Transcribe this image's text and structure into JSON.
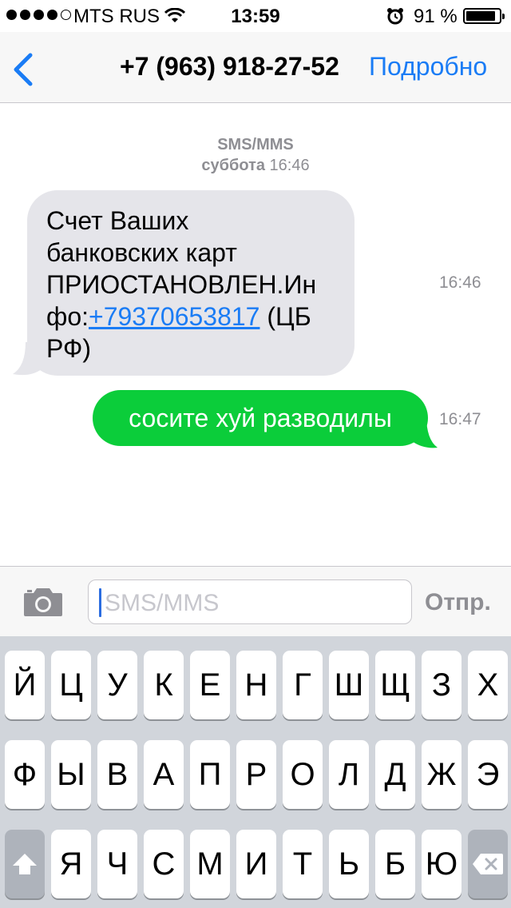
{
  "status_bar": {
    "carrier": "MTS RUS",
    "time": "13:59",
    "battery_percent": "91 %",
    "battery_level": 0.91,
    "signal_bars_filled": 4,
    "signal_bars_total": 5
  },
  "nav": {
    "back_icon": "chevron-left-icon",
    "title": "+7 (963) 918-27-52",
    "details_label": "Подробно"
  },
  "conversation": {
    "service_label": "SMS/MMS",
    "date_day": "суббота",
    "date_time": "16:46",
    "messages": [
      {
        "direction": "incoming",
        "lines": [
          "Счет Ваших",
          "банковских карт",
          "ПРИОСТАНОВЛЕН.Ин",
          "фо:"
        ],
        "link": "+79370653817",
        "after_link": " (ЦБ",
        "last_line": "РФ)",
        "time": "16:46"
      },
      {
        "direction": "outgoing",
        "text": "сосите хуй разводилы",
        "time": "16:47"
      }
    ]
  },
  "compose": {
    "camera_icon": "camera-icon",
    "placeholder": "SMS/MMS",
    "send_label": "Отпр."
  },
  "keyboard": {
    "rows": [
      [
        "Й",
        "Ц",
        "У",
        "К",
        "Е",
        "Н",
        "Г",
        "Ш",
        "Щ",
        "З",
        "Х"
      ],
      [
        "Ф",
        "Ы",
        "В",
        "А",
        "П",
        "Р",
        "О",
        "Л",
        "Д",
        "Ж",
        "Э"
      ],
      [
        "Я",
        "Ч",
        "С",
        "М",
        "И",
        "Т",
        "Ь",
        "Б",
        "Ю"
      ]
    ],
    "shift_icon": "shift-arrow-icon",
    "delete_icon": "backspace-icon"
  },
  "colors": {
    "accent_blue": "#1a7cf5",
    "outgoing_green": "#0bcd3a",
    "incoming_gray": "#e5e5ea",
    "keyboard_bg": "#d1d5db"
  }
}
